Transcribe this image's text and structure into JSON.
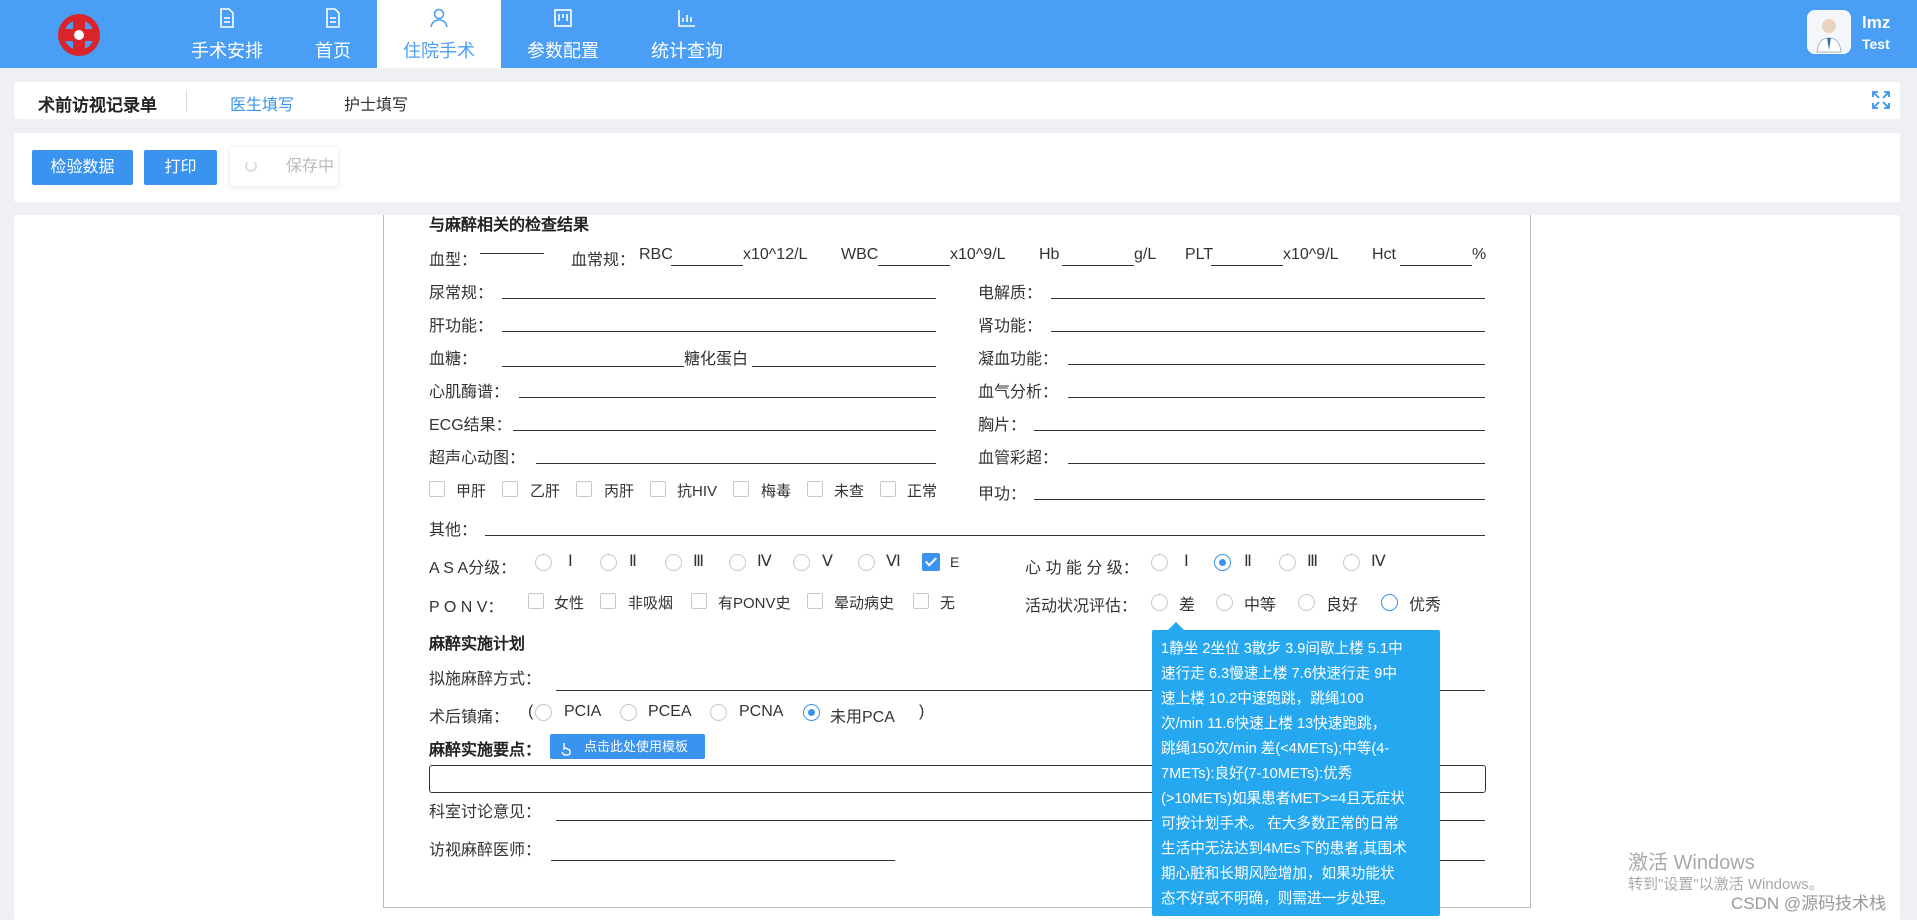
{
  "app": {
    "brand_color": "#4a9ef5",
    "accent_color": "#3a93ef",
    "tooltip_color": "#26a8f0"
  },
  "nav": [
    {
      "label": "手术安排",
      "icon": "document-icon"
    },
    {
      "label": "首页",
      "icon": "document-icon"
    },
    {
      "label": "住院手术",
      "icon": "user-icon",
      "active": true
    },
    {
      "label": "参数配置",
      "icon": "board-icon"
    },
    {
      "label": "统计查询",
      "icon": "bar-chart-icon"
    }
  ],
  "user": {
    "name": "lmz",
    "role": "Test"
  },
  "page": {
    "title": "术前访视记录单",
    "tabs": [
      "医生填写",
      "护士填写"
    ]
  },
  "toolbar": {
    "btn_check": "检验数据",
    "btn_print": "打印",
    "btn_saving": "保存中"
  },
  "form": {
    "sec1": "与麻醉相关的检查结果",
    "blood_type": "血型：",
    "blood_routine": "血常规：",
    "rbc": "RBC",
    "rbc_unit": "x10^12/L",
    "wbc": "WBC",
    "wbc_unit": "x10^9/L",
    "hb": "Hb",
    "hb_unit": "g/L",
    "plt": "PLT",
    "plt_unit": "x10^9/L",
    "hct": "Hct",
    "hct_unit": "%",
    "urine": "尿常规：",
    "electrolyte": "电解质：",
    "liver": "肝功能：",
    "kidney": "肾功能：",
    "glucose": "血糖：",
    "hba1c": "糖化蛋白",
    "coag": "凝血功能：",
    "myocard": "心肌酶谱：",
    "bloodgas": "血气分析：",
    "ecg": "ECG结果：",
    "chest": "胸片：",
    "echo": "超声心动图：",
    "vascular": "血管彩超：",
    "infect": [
      "甲肝",
      "乙肝",
      "丙肝",
      "抗HIV",
      "梅毒",
      "未查",
      "正常"
    ],
    "thyroid": "甲功：",
    "other": "其他：",
    "asa_label": "A S A分级：",
    "asa": [
      "Ⅰ",
      "Ⅱ",
      "Ⅲ",
      "Ⅳ",
      "Ⅴ",
      "Ⅵ"
    ],
    "asa_e": "E",
    "cardiac_label": "心 功 能 分 级：",
    "cardiac": [
      "Ⅰ",
      "Ⅱ",
      "Ⅲ",
      "Ⅳ"
    ],
    "ponv_label": "P O N V：",
    "ponv": [
      "女性",
      "非吸烟",
      "有PONV史",
      "晕动病史",
      "无"
    ],
    "activity_label": "活动状况评估：",
    "activity": [
      "差",
      "中等",
      "良好",
      "优秀"
    ],
    "sec2": "麻醉实施计划",
    "method": "拟施麻醉方式：",
    "analgesia": "术后镇痛：",
    "paren_open": "(",
    "paren_close": ")",
    "pca": [
      "PCIA",
      "PCEA",
      "PCNA",
      "未用PCA"
    ],
    "keypoints": "麻醉实施要点：",
    "template_btn": "点击此处使用模板",
    "discussion": "科室讨论意见：",
    "doctor": "访视麻醉医师："
  },
  "tooltip": [
    "1静坐 2坐位 3散步 3.9间歇上楼 5.1中",
    "速行走 6.3慢速上楼 7.6快速行走 9中",
    "速上楼 10.2中速跑跳，跳绳100",
    "次/min 11.6快速上楼 13快速跑跳，",
    "跳绳150次/min 差(<4METs);中等(4-",
    "7METs):良好(7-10METs):优秀",
    "(>10METs)如果患者MET>=4且无症状",
    "可按计划手术。 在大多数正常的日常",
    "生活中无法达到4MEs下的患者,其围术",
    "期心脏和长期风险增加，如果功能状",
    "态不好或不明确，则需进一步处理。"
  ],
  "watermark": {
    "title": "激活 Windows",
    "sub": "转到\"设置\"以激活 Windows。",
    "csdn": "CSDN @源码技术栈"
  }
}
